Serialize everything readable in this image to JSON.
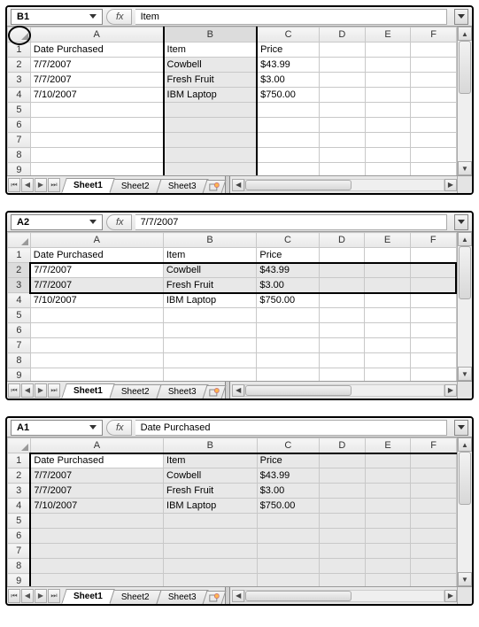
{
  "columns": [
    "A",
    "B",
    "C",
    "D",
    "E",
    "F"
  ],
  "row_numbers": [
    1,
    2,
    3,
    4,
    5,
    6,
    7,
    8,
    9
  ],
  "headers": {
    "A": "Date Purchased",
    "B": "Item",
    "C": "Price"
  },
  "rows": [
    {
      "A": "7/7/2007",
      "B": "Cowbell",
      "C": "$43.99"
    },
    {
      "A": "7/7/2007",
      "B": "Fresh Fruit",
      "C": "$3.00"
    },
    {
      "A": "7/10/2007",
      "B": "IBM Laptop",
      "C": "$750.00"
    }
  ],
  "tabs": {
    "items": [
      "Sheet1",
      "Sheet2",
      "Sheet3"
    ],
    "active": "Sheet1"
  },
  "fx_label": "fx",
  "panels": [
    {
      "name_box": "B1",
      "formula": "Item",
      "selection": "column-B"
    },
    {
      "name_box": "A2",
      "formula": "7/7/2007",
      "selection": "rows-2-3"
    },
    {
      "name_box": "A1",
      "formula": "Date Purchased",
      "selection": "all"
    }
  ],
  "chart_data": null
}
